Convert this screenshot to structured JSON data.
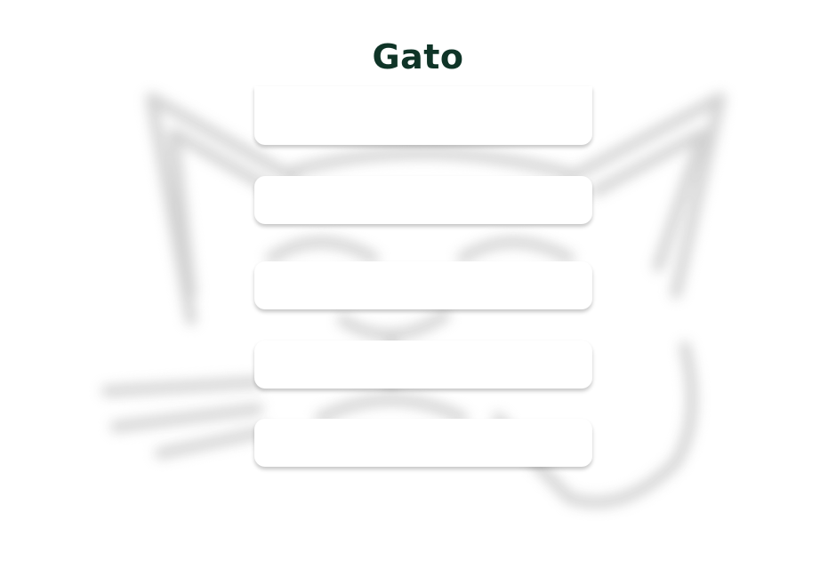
{
  "title": "Gato",
  "colors": {
    "background": "#ffffff",
    "title": "#0f3427",
    "button_bg": "#ffffff"
  },
  "background_image": "cat-outline-blurred",
  "buttons": [
    {
      "label": ""
    },
    {
      "label": ""
    },
    {
      "label": ""
    },
    {
      "label": ""
    },
    {
      "label": ""
    }
  ]
}
